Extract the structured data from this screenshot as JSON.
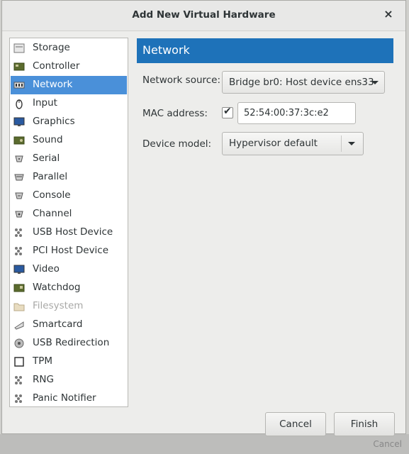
{
  "background": {
    "corner_text": "Cancel"
  },
  "dialog": {
    "title": "Add New Virtual Hardware",
    "close_glyph": "×",
    "buttons": {
      "cancel": "Cancel",
      "finish": "Finish"
    }
  },
  "sidebar": {
    "items": [
      {
        "label": "Storage",
        "icon": "storage-icon"
      },
      {
        "label": "Controller",
        "icon": "controller-icon"
      },
      {
        "label": "Network",
        "icon": "network-icon",
        "selected": true
      },
      {
        "label": "Input",
        "icon": "mouse-icon"
      },
      {
        "label": "Graphics",
        "icon": "monitor-icon"
      },
      {
        "label": "Sound",
        "icon": "sound-card-icon"
      },
      {
        "label": "Serial",
        "icon": "serial-port-icon"
      },
      {
        "label": "Parallel",
        "icon": "parallel-port-icon"
      },
      {
        "label": "Console",
        "icon": "console-icon"
      },
      {
        "label": "Channel",
        "icon": "channel-icon"
      },
      {
        "label": "USB Host Device",
        "icon": "usb-device-icon"
      },
      {
        "label": "PCI Host Device",
        "icon": "pci-device-icon"
      },
      {
        "label": "Video",
        "icon": "video-icon"
      },
      {
        "label": "Watchdog",
        "icon": "watchdog-icon"
      },
      {
        "label": "Filesystem",
        "icon": "folder-icon",
        "disabled": true
      },
      {
        "label": "Smartcard",
        "icon": "smartcard-icon"
      },
      {
        "label": "USB Redirection",
        "icon": "usb-redirection-icon"
      },
      {
        "label": "TPM",
        "icon": "tpm-icon"
      },
      {
        "label": "RNG",
        "icon": "rng-icon"
      },
      {
        "label": "Panic Notifier",
        "icon": "panic-notifier-icon"
      }
    ]
  },
  "network": {
    "header": "Network",
    "source_label": "Network source:",
    "source_value": "Bridge br0: Host device ens33",
    "mac_label": "MAC address:",
    "mac_checked": true,
    "mac_value": "52:54:00:37:3c:e2",
    "model_label": "Device model:",
    "model_value": "Hypervisor default"
  }
}
